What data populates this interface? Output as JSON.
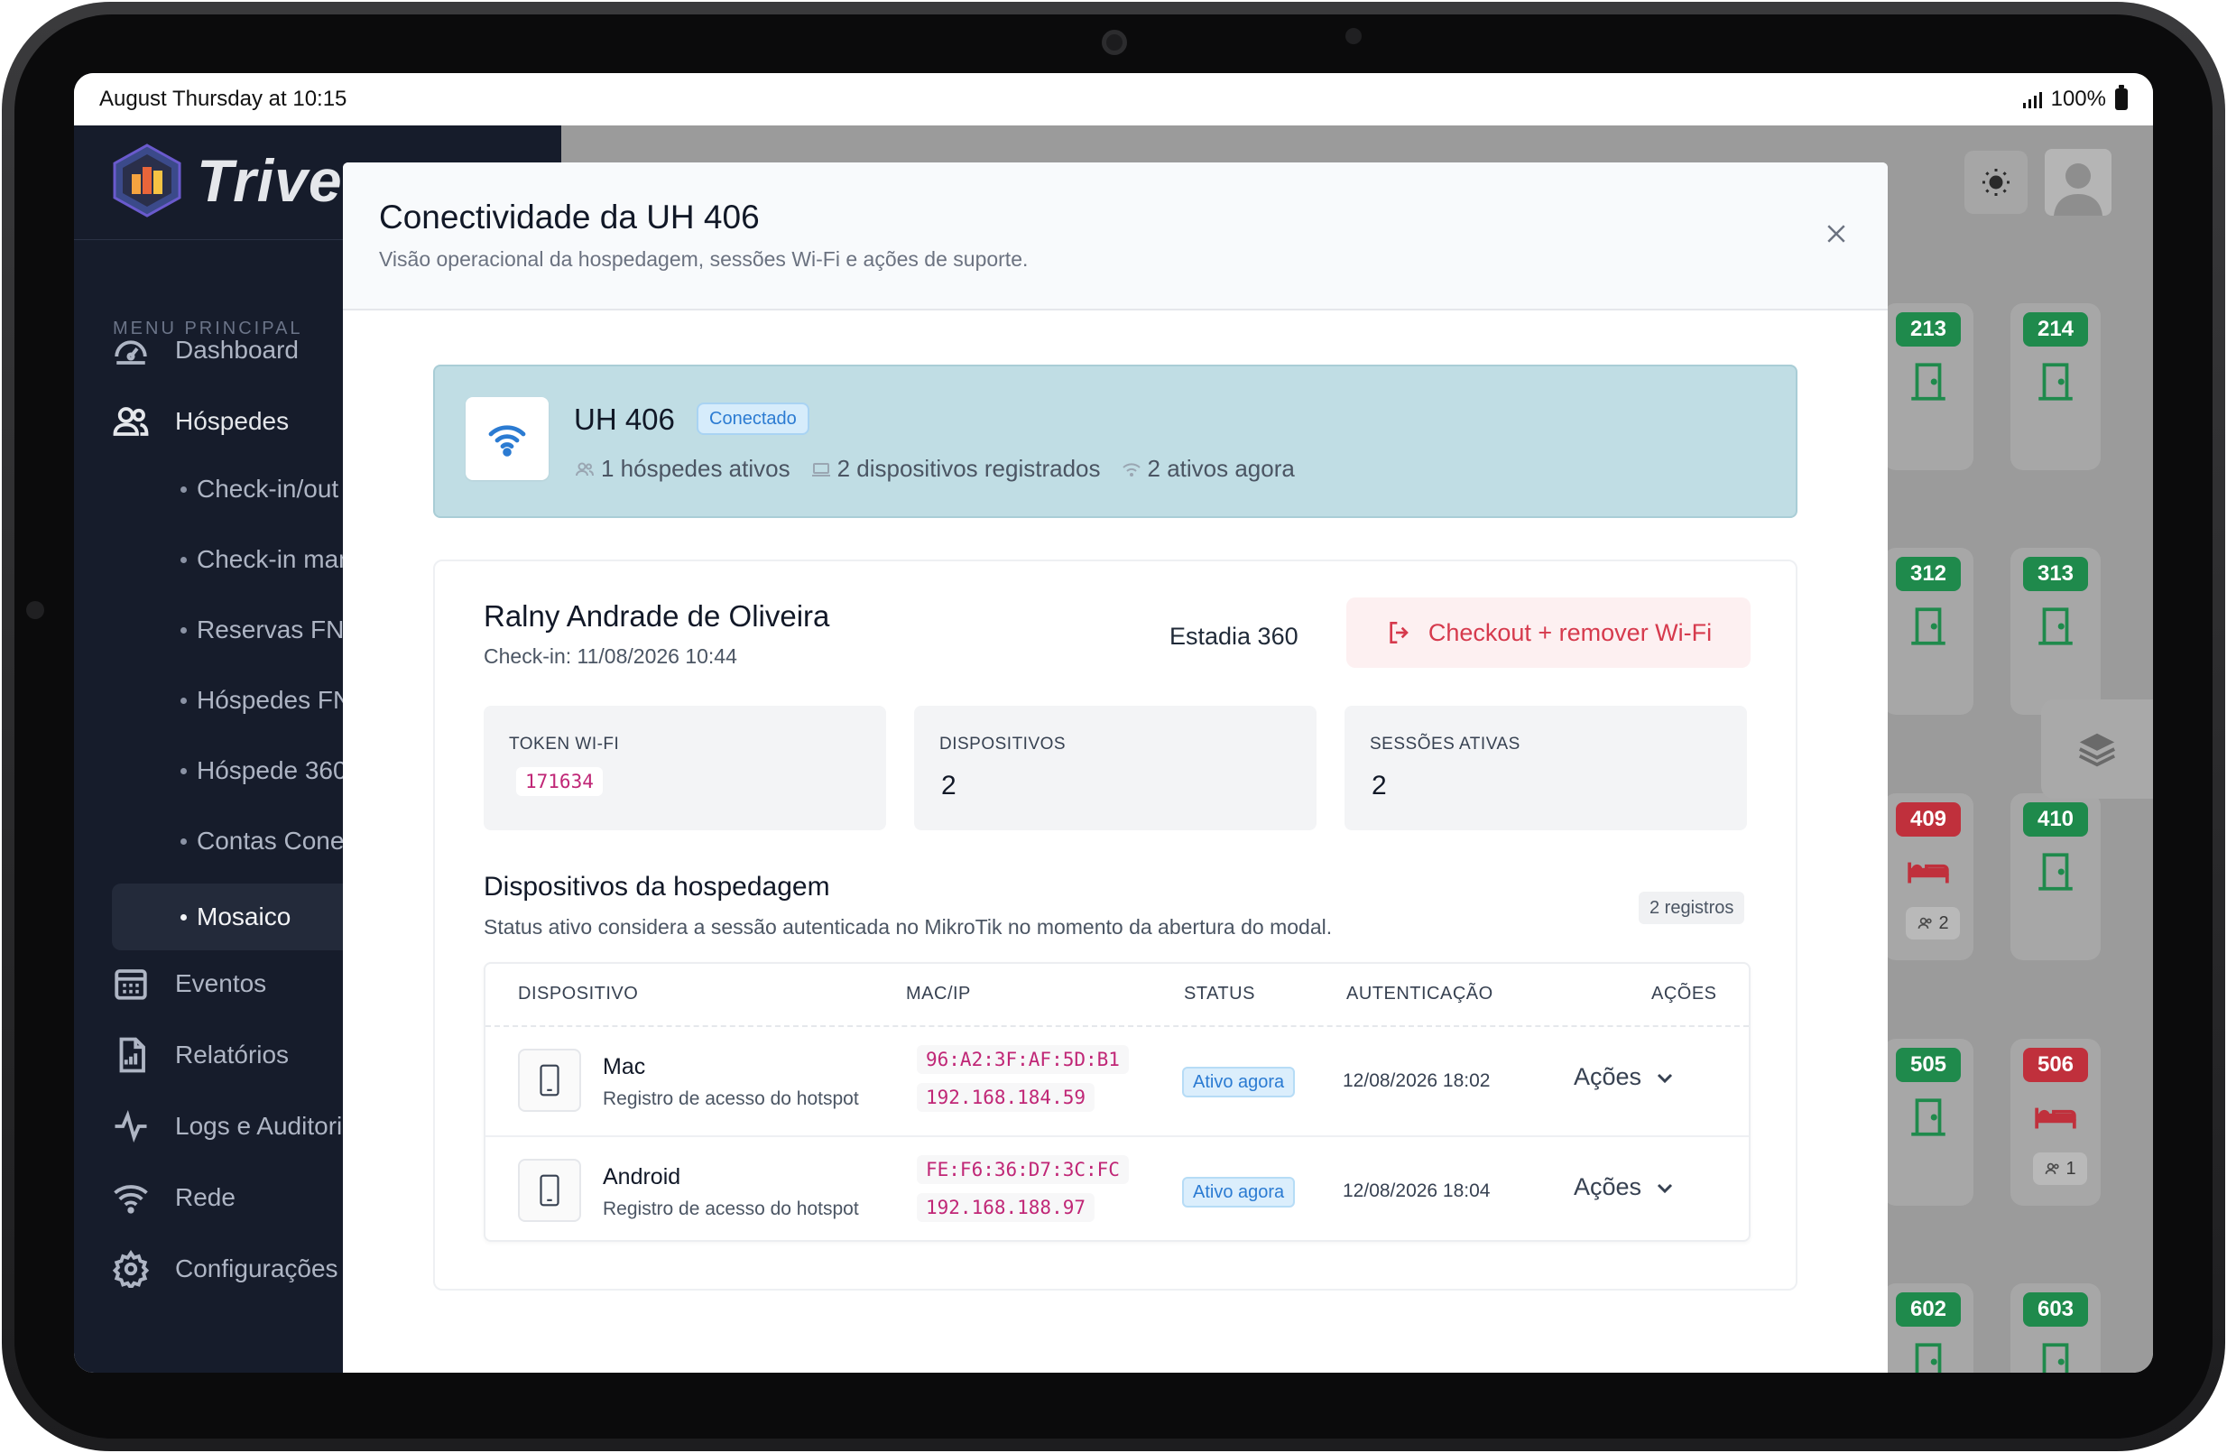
{
  "status_bar": {
    "time": "August Thursday at 10:15",
    "battery": "100%"
  },
  "sidebar": {
    "brand": "Trivec",
    "menu_title": "MENU PRINCIPAL",
    "items": {
      "dashboard": "Dashboard",
      "hospedes": "Hóspedes",
      "eventos": "Eventos",
      "relatorios": "Relatórios",
      "logs": "Logs e Auditoria",
      "rede": "Rede",
      "configuracoes": "Configurações"
    },
    "sub_items": [
      "Check-in/out",
      "Check-in manual",
      "Reservas FNRH",
      "Hóspedes FNRH",
      "Hóspede 360",
      "Contas Conectadas",
      "Mosaico"
    ],
    "active_sub_item": "Mosaico"
  },
  "mosaic": {
    "rooms": [
      {
        "number": "213",
        "status": "free",
        "color": "#1f8a4c"
      },
      {
        "number": "214",
        "status": "free",
        "color": "#1f8a4c"
      },
      {
        "number": "312",
        "status": "free",
        "color": "#1f8a4c"
      },
      {
        "number": "313",
        "status": "free",
        "color": "#1f8a4c"
      },
      {
        "number": "409",
        "status": "occupied",
        "color": "#c0303c",
        "guests": "2"
      },
      {
        "number": "410",
        "status": "free",
        "color": "#1f8a4c"
      },
      {
        "number": "505",
        "status": "free",
        "color": "#1f8a4c"
      },
      {
        "number": "506",
        "status": "occupied",
        "color": "#c0303c",
        "guests": "1"
      },
      {
        "number": "602",
        "status": "free",
        "color": "#1f8a4c"
      },
      {
        "number": "603",
        "status": "free",
        "color": "#1f8a4c"
      }
    ]
  },
  "modal": {
    "title": "Conectividade da UH 406",
    "subtitle": "Visão operacional da hospedagem, sessões Wi-Fi e ações de suporte.",
    "room": {
      "name": "UH 406",
      "status_badge": "Conectado",
      "active_guests": "1 hóspedes ativos",
      "registered_devices": "2 dispositivos registrados",
      "active_now": "2 ativos agora"
    },
    "stay": {
      "guest_name": "Ralny Andrade de Oliveira",
      "checkin": "Check-in: 11/08/2026 10:44",
      "stay_id": "Estadia 360",
      "checkout_button": "Checkout + remover Wi-Fi",
      "stats": {
        "token_label": "TOKEN WI-FI",
        "token_value": "171634",
        "devices_label": "DISPOSITIVOS",
        "devices_value": "2",
        "sessions_label": "SESSÕES ATIVAS",
        "sessions_value": "2"
      }
    },
    "devices": {
      "title": "Dispositivos da hospedagem",
      "subtitle": "Status ativo considera a sessão autenticada no MikroTik no momento da abertura do modal.",
      "count_badge": "2 registros",
      "columns": {
        "device": "DISPOSITIVO",
        "mac_ip": "MAC/IP",
        "status": "STATUS",
        "auth": "AUTENTICAÇÃO",
        "actions": "AÇÕES"
      },
      "rows": [
        {
          "name": "Mac",
          "description": "Registro de acesso do hotspot",
          "mac": "96:A2:3F:AF:5D:B1",
          "ip": "192.168.184.59",
          "status": "Ativo agora",
          "auth": "12/08/2026 18:02",
          "actions": "Ações"
        },
        {
          "name": "Android",
          "description": "Registro de acesso do hotspot",
          "mac": "FE:F6:36:D7:3C:FC",
          "ip": "192.168.188.97",
          "status": "Ativo agora",
          "auth": "12/08/2026 18:04",
          "actions": "Ações"
        }
      ]
    }
  }
}
